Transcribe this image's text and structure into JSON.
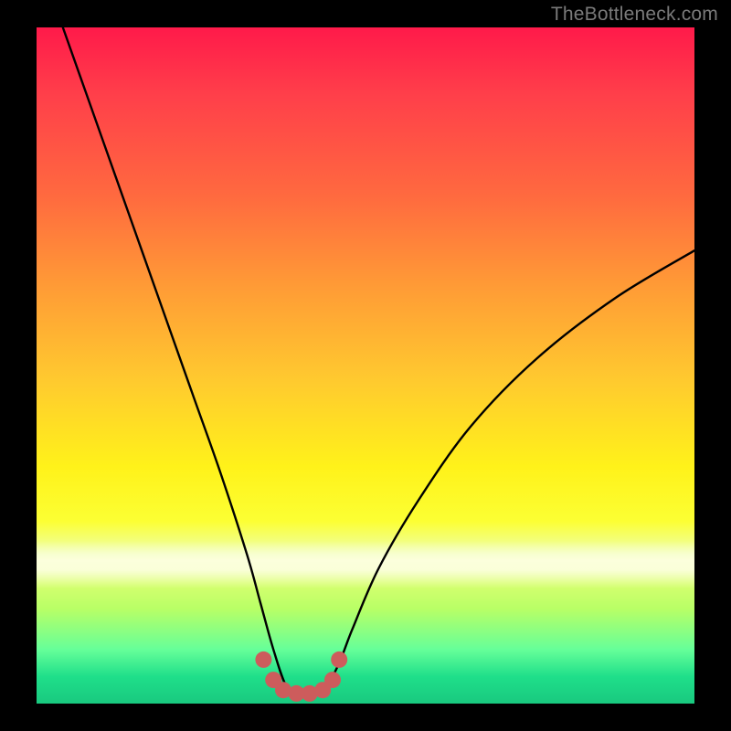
{
  "watermark": "TheBottleneck.com",
  "colors": {
    "background": "#000000",
    "curve": "#000000",
    "marker": "#cd5c5c",
    "watermark": "#7a7a7a"
  },
  "chart_data": {
    "type": "line",
    "title": "",
    "xlabel": "",
    "ylabel": "",
    "xlim": [
      0,
      100
    ],
    "ylim": [
      0,
      100
    ],
    "grid": false,
    "legend": false,
    "background_gradient": [
      "#ff1a4a",
      "#ff9a36",
      "#fff21a",
      "#19c97f"
    ],
    "series": [
      {
        "name": "bottleneck-curve",
        "x": [
          4,
          8,
          12,
          16,
          20,
          24,
          28,
          32,
          34,
          36,
          38,
          40,
          42,
          44,
          46,
          48,
          52,
          58,
          66,
          76,
          88,
          100
        ],
        "y": [
          100,
          89,
          78,
          67,
          56,
          45,
          34,
          22,
          15,
          8,
          2.5,
          1.5,
          1.5,
          2.5,
          6,
          11,
          20,
          30,
          41,
          51,
          60,
          67
        ]
      }
    ],
    "markers": [
      {
        "x": 34.5,
        "y": 6.5
      },
      {
        "x": 36.0,
        "y": 3.5
      },
      {
        "x": 37.5,
        "y": 2.0
      },
      {
        "x": 39.5,
        "y": 1.5
      },
      {
        "x": 41.5,
        "y": 1.5
      },
      {
        "x": 43.5,
        "y": 2.0
      },
      {
        "x": 45.0,
        "y": 3.5
      },
      {
        "x": 46.0,
        "y": 6.5
      }
    ],
    "marker_style": {
      "shape": "circle",
      "radius_px": 9,
      "color": "#cd5c5c"
    }
  }
}
